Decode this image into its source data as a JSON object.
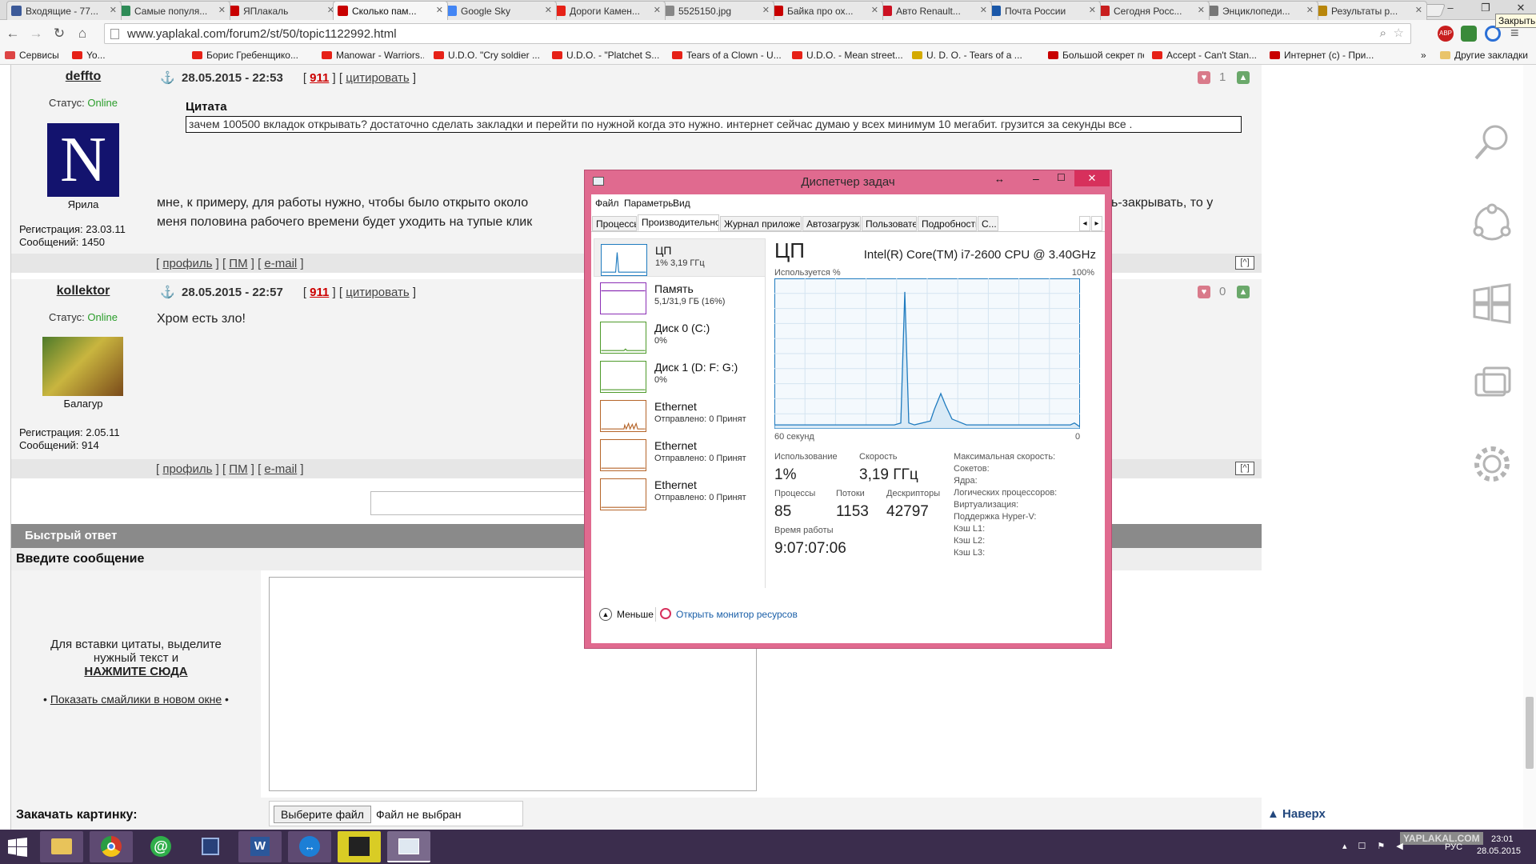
{
  "tabs": [
    {
      "title": "Входящие - 77...",
      "color": "#3b5998"
    },
    {
      "title": "Самые популя...",
      "color": "#2e8b57"
    },
    {
      "title": "ЯПлакаль",
      "color": "#c80000"
    },
    {
      "title": "Сколько пам...",
      "color": "#c80000"
    },
    {
      "title": "Google Sky",
      "color": "#4285f4"
    },
    {
      "title": "Дороги Камен...",
      "color": "#e62117"
    },
    {
      "title": "5525150.jpg",
      "color": "#888888"
    },
    {
      "title": "Байка про ох...",
      "color": "#c80000"
    },
    {
      "title": "Авто Renault...",
      "color": "#cc1122"
    },
    {
      "title": "Почта России",
      "color": "#1a57a8"
    },
    {
      "title": "Сегодня Росс...",
      "color": "#c81e1e"
    },
    {
      "title": "Энциклопеди...",
      "color": "#777777"
    },
    {
      "title": "Результаты р...",
      "color": "#b8860b"
    }
  ],
  "tooltip": "Закрыть",
  "url": "www.yaplakal.com/forum2/st/50/topic1122992.html",
  "bookmarks": [
    {
      "label": "Сервисы",
      "color": "#dd4444"
    },
    {
      "label": "Yo...",
      "color": "#e62117"
    },
    {
      "label": "Борис Гребенщико...",
      "color": "#e62117"
    },
    {
      "label": "Manowar - Warriors...",
      "color": "#e62117"
    },
    {
      "label": "U.D.O. \"Cry soldier ...",
      "color": "#e62117"
    },
    {
      "label": "U.D.O. - \"Platchet S...",
      "color": "#e62117"
    },
    {
      "label": "Tears of a Clown - U...",
      "color": "#e62117"
    },
    {
      "label": "U.D.O. - Mean street...",
      "color": "#e62117"
    },
    {
      "label": "U. D. O. - Tears of a ...",
      "color": "#d4aa00"
    },
    {
      "label": "Большой секрет пе...",
      "color": "#c80000"
    },
    {
      "label": "Accept - Can't Stan...",
      "color": "#e62117"
    },
    {
      "label": "Интернет (с) - При...",
      "color": "#c80000"
    }
  ],
  "other_bookmarks": "Другие закладки",
  "posts": [
    {
      "user": "deffto",
      "date": "28.05.2015 - 22:53",
      "num": "911",
      "quote_label": "цитировать",
      "status_label": "Статус:",
      "status": "Online",
      "avatar_letter": "N",
      "rank": "Ярила",
      "reg": "Регистрация: 23.03.11",
      "msgs": "Сообщений: 1450",
      "votes": "1",
      "quote_title": "Цитата",
      "quote_text": "зачем 100500 вкладок открывать? достаточно сделать закладки и перейти по нужной когда это нужно. интернет сейчас думаю у всех минимум 10 мегабит. грузится за секунды все .",
      "text_line1a": "мне, к примеру, для работы нужно, чтобы было открыто около",
      "text_line1b": "ь-закрывать, то у",
      "text_line2": "меня половина рабочего времени будет уходить на тупые клик"
    },
    {
      "user": "kollektor",
      "date": "28.05.2015 - 22:57",
      "num": "911",
      "quote_label": "цитировать",
      "status_label": "Статус:",
      "status": "Online",
      "rank": "Балагур",
      "reg": "Регистрация: 2.05.11",
      "msgs": "Сообщений: 914",
      "votes": "0",
      "text": "Хром есть зло!"
    }
  ],
  "actions": {
    "profile": "профиль",
    "pm": "ПМ",
    "email": "e-mail",
    "up": "[^]"
  },
  "quick_reply": "Быстрый ответ",
  "enter_message": "Введите сообщение",
  "hint1": "Для вставки цитаты, выделите",
  "hint2": "нужный текст и",
  "hint3": "НАЖМИТЕ СЮДА",
  "smilies": "Показать смайлики в новом окне",
  "upload_label": "Закачать картинку:",
  "file_button": "Выберите файл",
  "file_none": "Файл не выбран",
  "back_to_top": "Наверх",
  "watermark": "YAPLAKAL.COM",
  "taskmgr": {
    "title": "Диспетчер задач",
    "menu": [
      "Файл",
      "Параметры",
      "Вид"
    ],
    "tabs": [
      "Процессы",
      "Производительность",
      "Журнал приложений",
      "Автозагрузка",
      "Пользователи",
      "Подробности",
      "С..."
    ],
    "resources": [
      {
        "name": "ЦП",
        "sub": "1% 3,19 ГГц",
        "color": "#1f7bbf"
      },
      {
        "name": "Память",
        "sub": "5,1/31,9 ГБ (16%)",
        "color": "#8b2fb5"
      },
      {
        "name": "Диск 0 (C:)",
        "sub": "0%",
        "color": "#4d9a2a"
      },
      {
        "name": "Диск 1 (D: F: G:)",
        "sub": "0%",
        "color": "#4d9a2a"
      },
      {
        "name": "Ethernet",
        "sub": "Отправлено: 0 Принят",
        "color": "#b5652a"
      },
      {
        "name": "Ethernet",
        "sub": "Отправлено: 0 Принят",
        "color": "#b5652a"
      },
      {
        "name": "Ethernet",
        "sub": "Отправлено: 0 Принят",
        "color": "#b5652a"
      }
    ],
    "cpu_title": "ЦП",
    "cpu_model": "Intel(R) Core(TM) i7-2600 CPU @ 3.40GHz",
    "usage_label": "Используется %",
    "max_label": "100%",
    "time_label": "60 секунд",
    "zero_label": "0",
    "stats": {
      "util_label": "Использование",
      "util": "1%",
      "speed_label": "Скорость",
      "speed": "3,19 ГГц",
      "proc_label": "Процессы",
      "proc": "85",
      "threads_label": "Потоки",
      "threads": "1153",
      "handles_label": "Дескрипторы",
      "handles": "42797",
      "uptime_label": "Время работы",
      "uptime": "9:07:07:06"
    },
    "specs": [
      "Максимальная скорость:",
      "Сокетов:",
      "Ядра:",
      "Логических процессоров:",
      "Виртуализация:",
      "Поддержка Hyper-V:",
      "Кэш L1:",
      "Кэш L2:",
      "Кэш L3:"
    ],
    "less": "Меньше",
    "monitor": "Открыть монитор ресурсов"
  },
  "tray": {
    "lang": "РУС",
    "time": "23:01",
    "date": "28.05.2015"
  }
}
